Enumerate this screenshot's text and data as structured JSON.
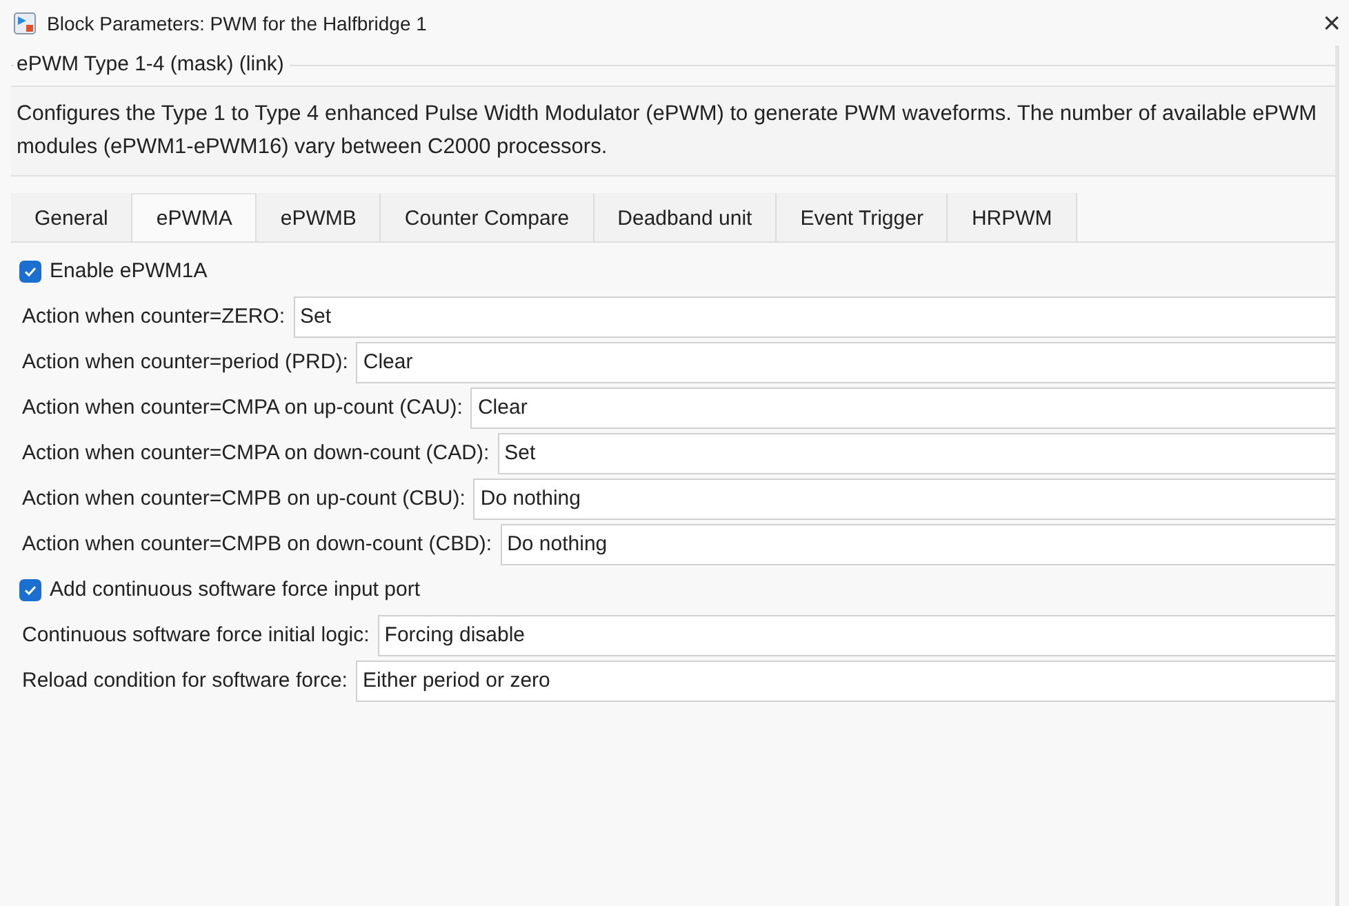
{
  "window": {
    "title": "Block Parameters: PWM for the Halfbridge 1",
    "close": "×"
  },
  "group": {
    "title": "ePWM Type 1-4 (mask) (link)",
    "description": "Configures the Type 1 to Type 4 enhanced Pulse Width Modulator (ePWM) to generate PWM waveforms. The number of available ePWM modules (ePWM1-ePWM16) vary between C2000 processors."
  },
  "tabs": [
    {
      "label": "General",
      "selected": false
    },
    {
      "label": "ePWMA",
      "selected": true
    },
    {
      "label": "ePWMB",
      "selected": false
    },
    {
      "label": "Counter Compare",
      "selected": false
    },
    {
      "label": "Deadband unit",
      "selected": false
    },
    {
      "label": "Event Trigger",
      "selected": false
    },
    {
      "label": "HRPWM",
      "selected": false
    }
  ],
  "parameters": [
    {
      "kind": "checkbox",
      "label": "Enable ePWM1A",
      "checked": true
    },
    {
      "kind": "field",
      "label": "Action when counter=ZERO:",
      "value": "Set"
    },
    {
      "kind": "field",
      "label": "Action when counter=period (PRD):",
      "value": "Clear"
    },
    {
      "kind": "field",
      "label": "Action when counter=CMPA on up-count (CAU):",
      "value": "Clear"
    },
    {
      "kind": "field",
      "label": "Action when counter=CMPA on down-count (CAD):",
      "value": "Set"
    },
    {
      "kind": "field",
      "label": "Action when counter=CMPB on up-count (CBU):",
      "value": "Do nothing"
    },
    {
      "kind": "field",
      "label": "Action when counter=CMPB on down-count (CBD):",
      "value": "Do nothing"
    },
    {
      "kind": "checkbox",
      "label": "Add continuous software force input port",
      "checked": true
    },
    {
      "kind": "field",
      "label": "Continuous software force initial logic:",
      "value": "Forcing disable"
    },
    {
      "kind": "field",
      "label": "Reload condition for software force:",
      "value": "Either period or zero"
    }
  ]
}
